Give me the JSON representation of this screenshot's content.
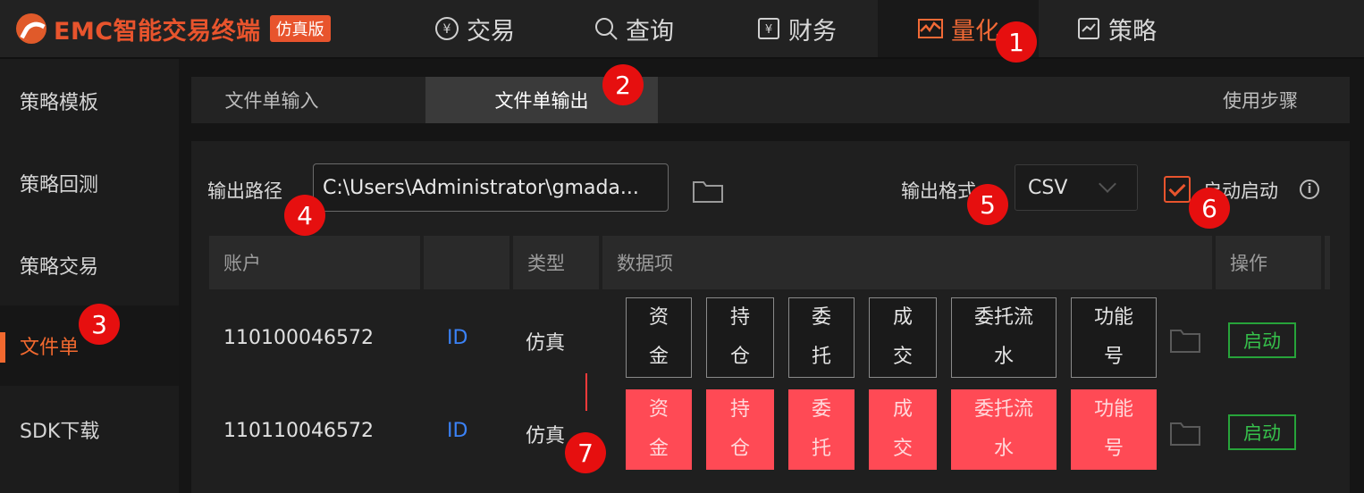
{
  "app": {
    "title": "EMC智能交易终端",
    "edition_badge": "仿真版"
  },
  "nav": [
    {
      "label": "交易",
      "icon": "yen-circle-icon"
    },
    {
      "label": "查询",
      "icon": "search-icon"
    },
    {
      "label": "财务",
      "icon": "finance-icon"
    },
    {
      "label": "量化",
      "icon": "quant-chart-icon",
      "active": true
    },
    {
      "label": "策略",
      "icon": "strategy-icon"
    }
  ],
  "sidebar": {
    "items": [
      {
        "label": "策略模板"
      },
      {
        "label": "策略回测"
      },
      {
        "label": "策略交易"
      },
      {
        "label": "文件单",
        "active": true
      },
      {
        "label": "SDK下载"
      }
    ]
  },
  "subtabs": {
    "input_label": "文件单输入",
    "output_label": "文件单输出",
    "steps_label": "使用步骤"
  },
  "settings": {
    "output_path_label": "输出路径",
    "output_path_value": "C:\\Users\\Administrator\\gmada...",
    "output_format_label": "输出格式",
    "output_format_value": "CSV",
    "auto_start_label": "启动启动",
    "auto_start_checked": true
  },
  "table": {
    "headers": {
      "account": "账户",
      "blank": "",
      "type": "类型",
      "data_items": "数据项",
      "ops": "操作"
    },
    "rows": [
      {
        "account": "110100046572",
        "id": "ID",
        "type": "仿真",
        "items": [
          {
            "line1": "资",
            "line2": "金"
          },
          {
            "line1": "持",
            "line2": "仓"
          },
          {
            "line1": "委",
            "line2": "托"
          },
          {
            "line1": "成",
            "line2": "交"
          },
          {
            "line1": "委托流",
            "line2": "水"
          },
          {
            "line1": "功能",
            "line2": "号"
          }
        ],
        "selected": false,
        "action": "启动"
      },
      {
        "account": "110110046572",
        "id": "ID",
        "type": "仿真",
        "items": [
          {
            "line1": "资",
            "line2": "金"
          },
          {
            "line1": "持",
            "line2": "仓"
          },
          {
            "line1": "委",
            "line2": "托"
          },
          {
            "line1": "成",
            "line2": "交"
          },
          {
            "line1": "委托流",
            "line2": "水"
          },
          {
            "line1": "功能",
            "line2": "号"
          }
        ],
        "selected": true,
        "action": "启动"
      }
    ]
  },
  "annotations": [
    "1",
    "2",
    "3",
    "4",
    "5",
    "6",
    "7"
  ],
  "colors": {
    "accent": "#f26a36",
    "badge": "#e60f0f",
    "selected": "#ff4a55",
    "start": "#27a33a",
    "link": "#3b82f6"
  }
}
